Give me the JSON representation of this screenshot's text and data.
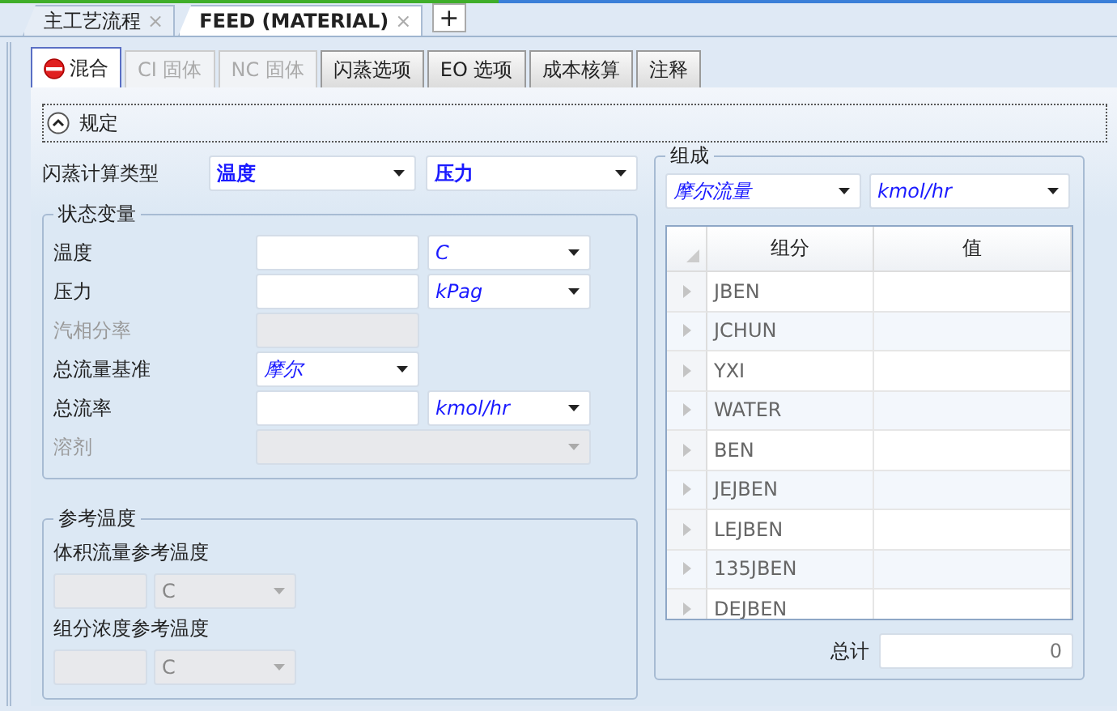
{
  "doc_tabs": [
    {
      "label": "主工艺流程",
      "selected": false,
      "close": "×"
    },
    {
      "label": "FEED (MATERIAL)",
      "selected": true,
      "close": "×"
    }
  ],
  "add_tab": "+",
  "tabs": [
    {
      "label": "混合",
      "selected": true,
      "disabled": false,
      "has_icon": true
    },
    {
      "label": "CI 固体",
      "selected": false,
      "disabled": true,
      "has_icon": false
    },
    {
      "label": "NC 固体",
      "selected": false,
      "disabled": true,
      "has_icon": false
    },
    {
      "label": "闪蒸选项",
      "selected": false,
      "disabled": false,
      "has_icon": false
    },
    {
      "label": "EO 选项",
      "selected": false,
      "disabled": false,
      "has_icon": false
    },
    {
      "label": "成本核算",
      "selected": false,
      "disabled": false,
      "has_icon": false
    },
    {
      "label": "注释",
      "selected": false,
      "disabled": false,
      "has_icon": false
    }
  ],
  "section": {
    "title": "规定",
    "expanded": true
  },
  "flash_type": {
    "label": "闪蒸计算类型",
    "spec_1": "温度",
    "spec_2": "压力"
  },
  "state_variables": {
    "title": "状态变量",
    "rows": [
      {
        "label": "温度",
        "kind": "value_unit",
        "disabled": false,
        "unit": "C"
      },
      {
        "label": "压力",
        "kind": "value_unit",
        "disabled": false,
        "unit": "kPag"
      },
      {
        "label": "汽相分率",
        "kind": "value",
        "disabled": true
      },
      {
        "label": "总流量基准",
        "kind": "combo",
        "disabled": false,
        "value": "摩尔"
      },
      {
        "label": "总流率",
        "kind": "value_unit",
        "disabled": false,
        "unit": "kmol/hr"
      },
      {
        "label": "溶剂",
        "kind": "combo",
        "disabled": true
      }
    ]
  },
  "reference_temperature": {
    "title": "参考温度",
    "items": [
      {
        "label": "体积流量参考温度",
        "unit": "C",
        "disabled": true
      },
      {
        "label": "组分浓度参考温度",
        "unit": "C",
        "disabled": true
      }
    ]
  },
  "composition": {
    "title": "组成",
    "basis": "摩尔流量",
    "units": "kmol/hr",
    "columns": [
      "组分",
      "值"
    ],
    "rows": [
      {
        "component": "JBEN"
      },
      {
        "component": "JCHUN"
      },
      {
        "component": "YXI"
      },
      {
        "component": "WATER"
      },
      {
        "component": "BEN"
      },
      {
        "component": "JEJBEN"
      },
      {
        "component": "LEJBEN"
      },
      {
        "component": "135JBEN"
      },
      {
        "component": "DEJBEN"
      }
    ],
    "total_label": "总计",
    "total": "0"
  }
}
